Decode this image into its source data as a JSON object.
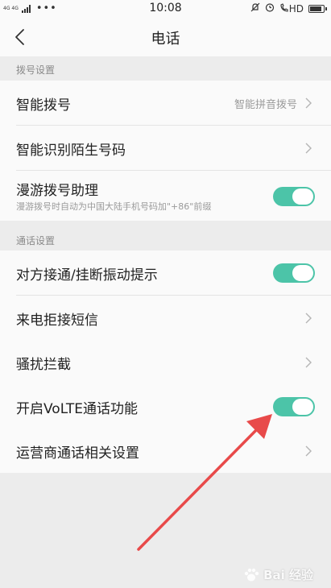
{
  "status_bar": {
    "network": "4G 4G",
    "more": "•••",
    "time": "10:08",
    "hd": "HD",
    "battery_level": 0.85
  },
  "header": {
    "title": "电话"
  },
  "sections": [
    {
      "header": "拨号设置",
      "rows": [
        {
          "title": "智能拨号",
          "value": "智能拼音拨号"
        },
        {
          "title": "智能识别陌生号码"
        },
        {
          "title": "漫游拨号助理",
          "subtitle": "漫游拨号时自动为中国大陆手机号码加\"+86\"前缀",
          "toggle": true
        }
      ]
    },
    {
      "header": "通话设置",
      "rows": [
        {
          "title": "对方接通/挂断振动提示",
          "toggle": true
        },
        {
          "title": "来电拒接短信"
        },
        {
          "title": "骚扰拦截"
        },
        {
          "title": "开启VoLTE通话功能",
          "toggle": true
        },
        {
          "title": "运营商通话相关设置"
        }
      ]
    }
  ],
  "watermark": "Bai 经验",
  "colors": {
    "toggle_on": "#4cc4a8",
    "arrow": "#e84a4a"
  }
}
